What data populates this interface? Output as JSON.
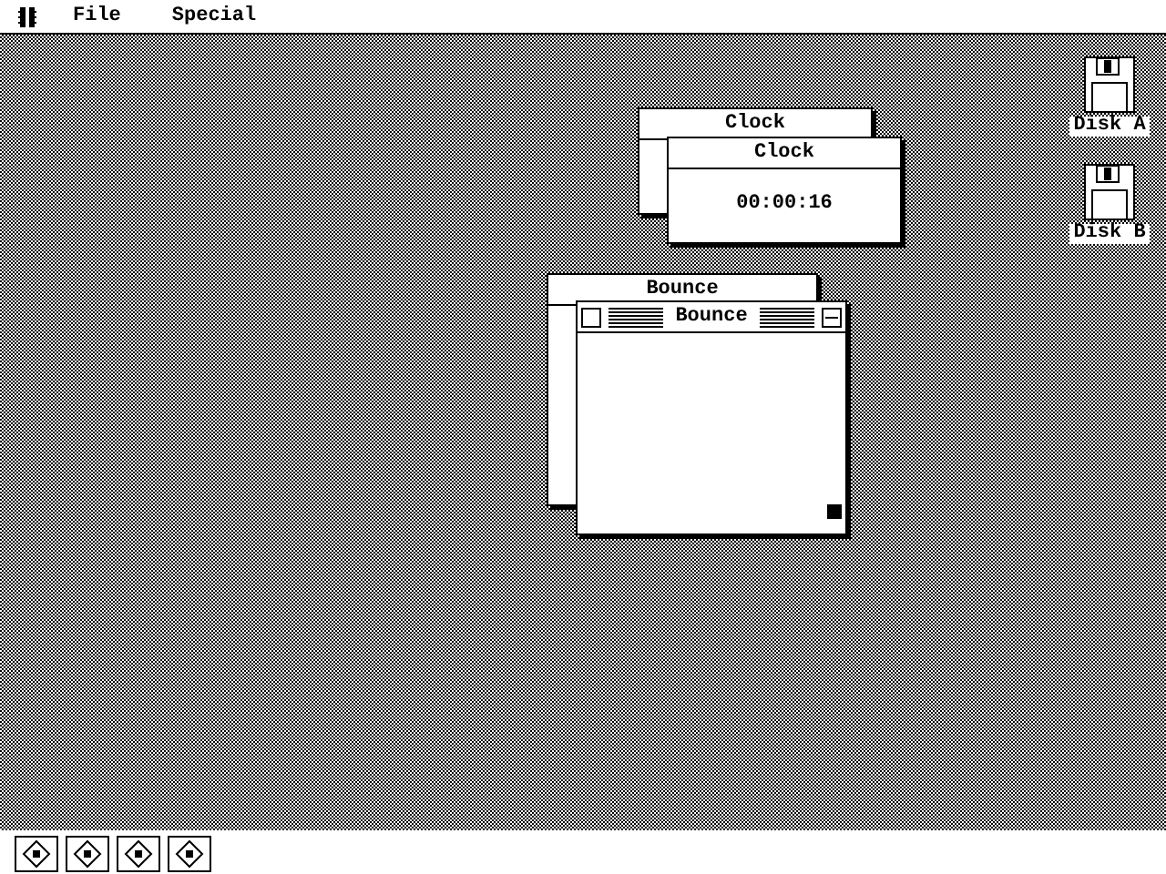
{
  "menu_bar": {
    "items": [
      "File",
      "Special"
    ]
  },
  "windows": [
    {
      "title": "Clock",
      "active": false
    },
    {
      "title": "Clock",
      "active": false,
      "text": "00:00:16"
    },
    {
      "title": "Bounce",
      "active": false
    },
    {
      "title": "Bounce",
      "active": true
    }
  ],
  "desktop_icons": [
    {
      "label": "Disk A"
    },
    {
      "label": "Disk B"
    }
  ]
}
